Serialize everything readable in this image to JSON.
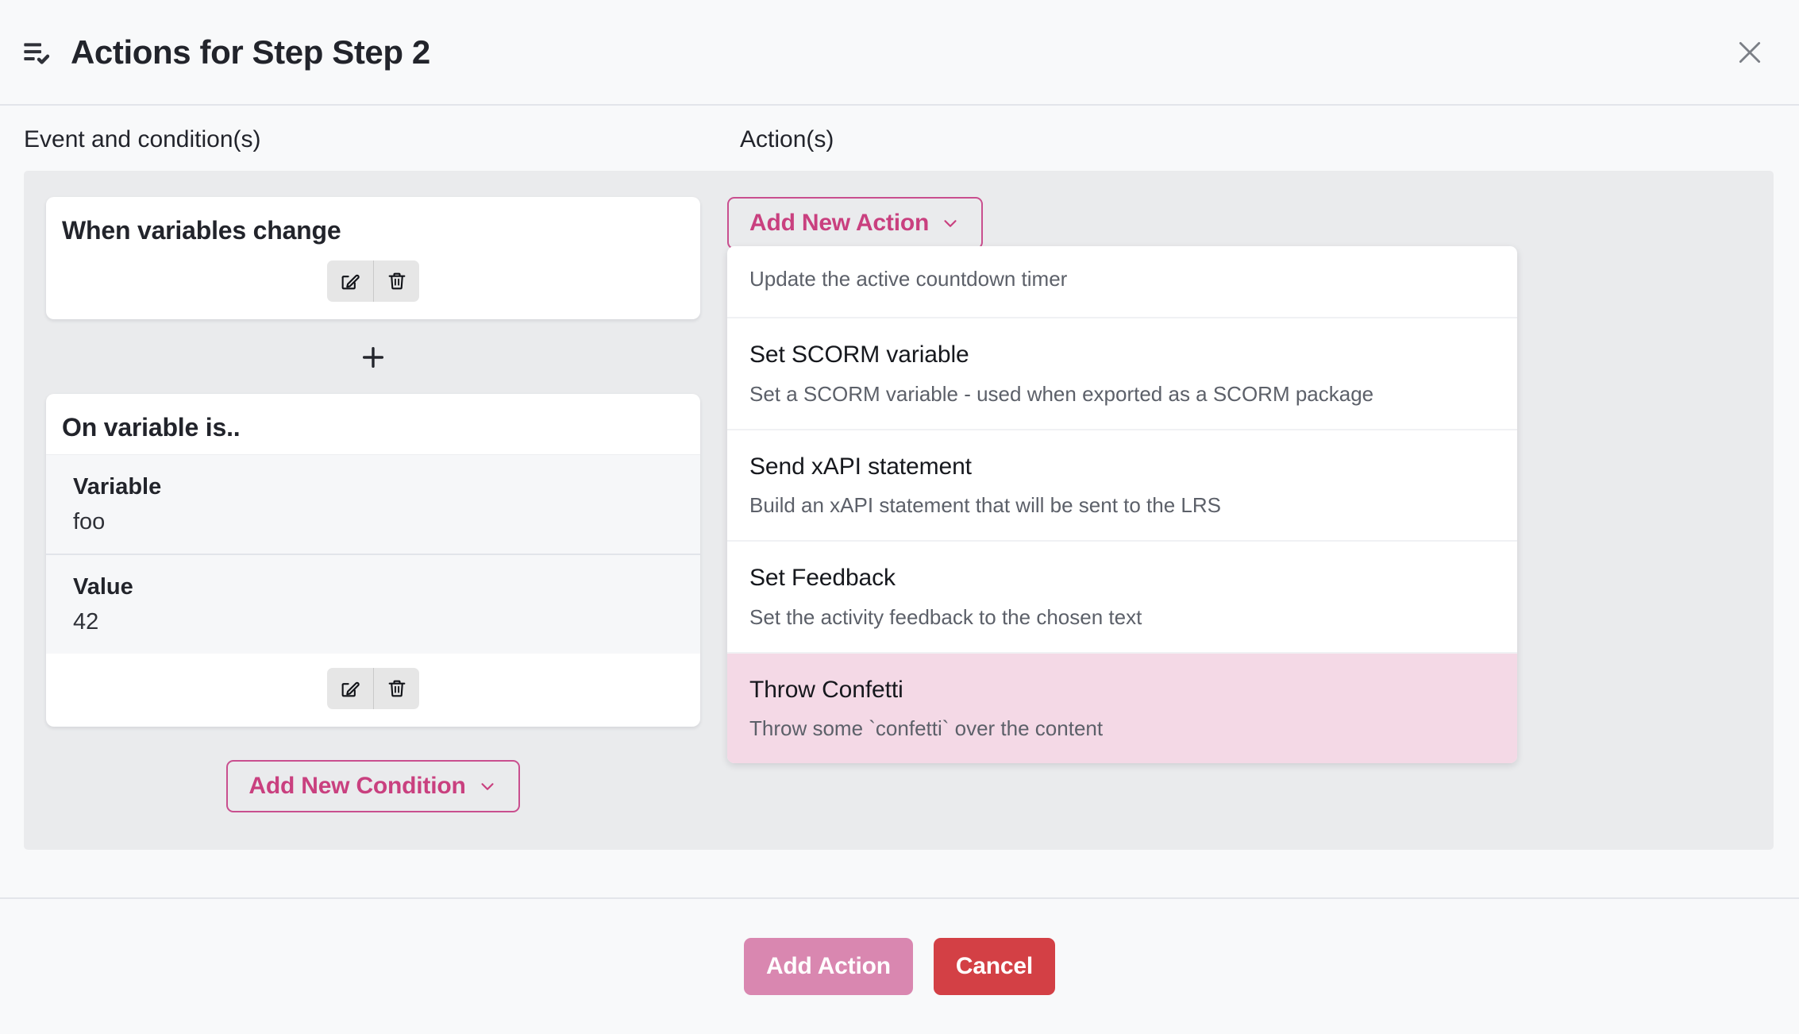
{
  "header": {
    "icon": "list-check-icon",
    "title": "Actions for Step Step 2",
    "close_icon": "close-icon"
  },
  "columns": {
    "left_heading": "Event and condition(s)",
    "right_heading": "Action(s)"
  },
  "conditions": {
    "event_card": {
      "title": "When variables change",
      "edit_icon": "edit-icon",
      "delete_icon": "trash-icon"
    },
    "add_between_icon": "plus-icon",
    "condition_card": {
      "title": "On variable is..",
      "rows": [
        {
          "label": "Variable",
          "value": "foo"
        },
        {
          "label": "Value",
          "value": "42"
        }
      ],
      "edit_icon": "edit-icon",
      "delete_icon": "trash-icon"
    },
    "add_condition_label": "Add New Condition",
    "add_condition_chevron": "chevron-down-icon"
  },
  "actions": {
    "add_action_label": "Add New Action",
    "add_action_chevron": "chevron-down-icon",
    "dropdown": [
      {
        "title": "",
        "description": "Update the active countdown timer",
        "highlighted": false
      },
      {
        "title": "Set SCORM variable",
        "description": "Set a SCORM variable - used when exported as a SCORM package",
        "highlighted": false
      },
      {
        "title": "Send xAPI statement",
        "description": "Build an xAPI statement that will be sent to the LRS",
        "highlighted": false
      },
      {
        "title": "Set Feedback",
        "description": "Set the activity feedback to the chosen text",
        "highlighted": false
      },
      {
        "title": "Throw Confetti",
        "description": "Throw some `confetti` over the content",
        "highlighted": true
      }
    ]
  },
  "footer": {
    "primary_label": "Add Action",
    "cancel_label": "Cancel"
  },
  "colors": {
    "accent_pink": "#c9407f",
    "accent_pink_border": "#c94f8f",
    "primary_button": "#d987b0",
    "cancel_button": "#d34045",
    "highlight_row": "#f4d9e6",
    "panel_gray": "#eaebed",
    "page_bg": "#f8f9fa"
  }
}
